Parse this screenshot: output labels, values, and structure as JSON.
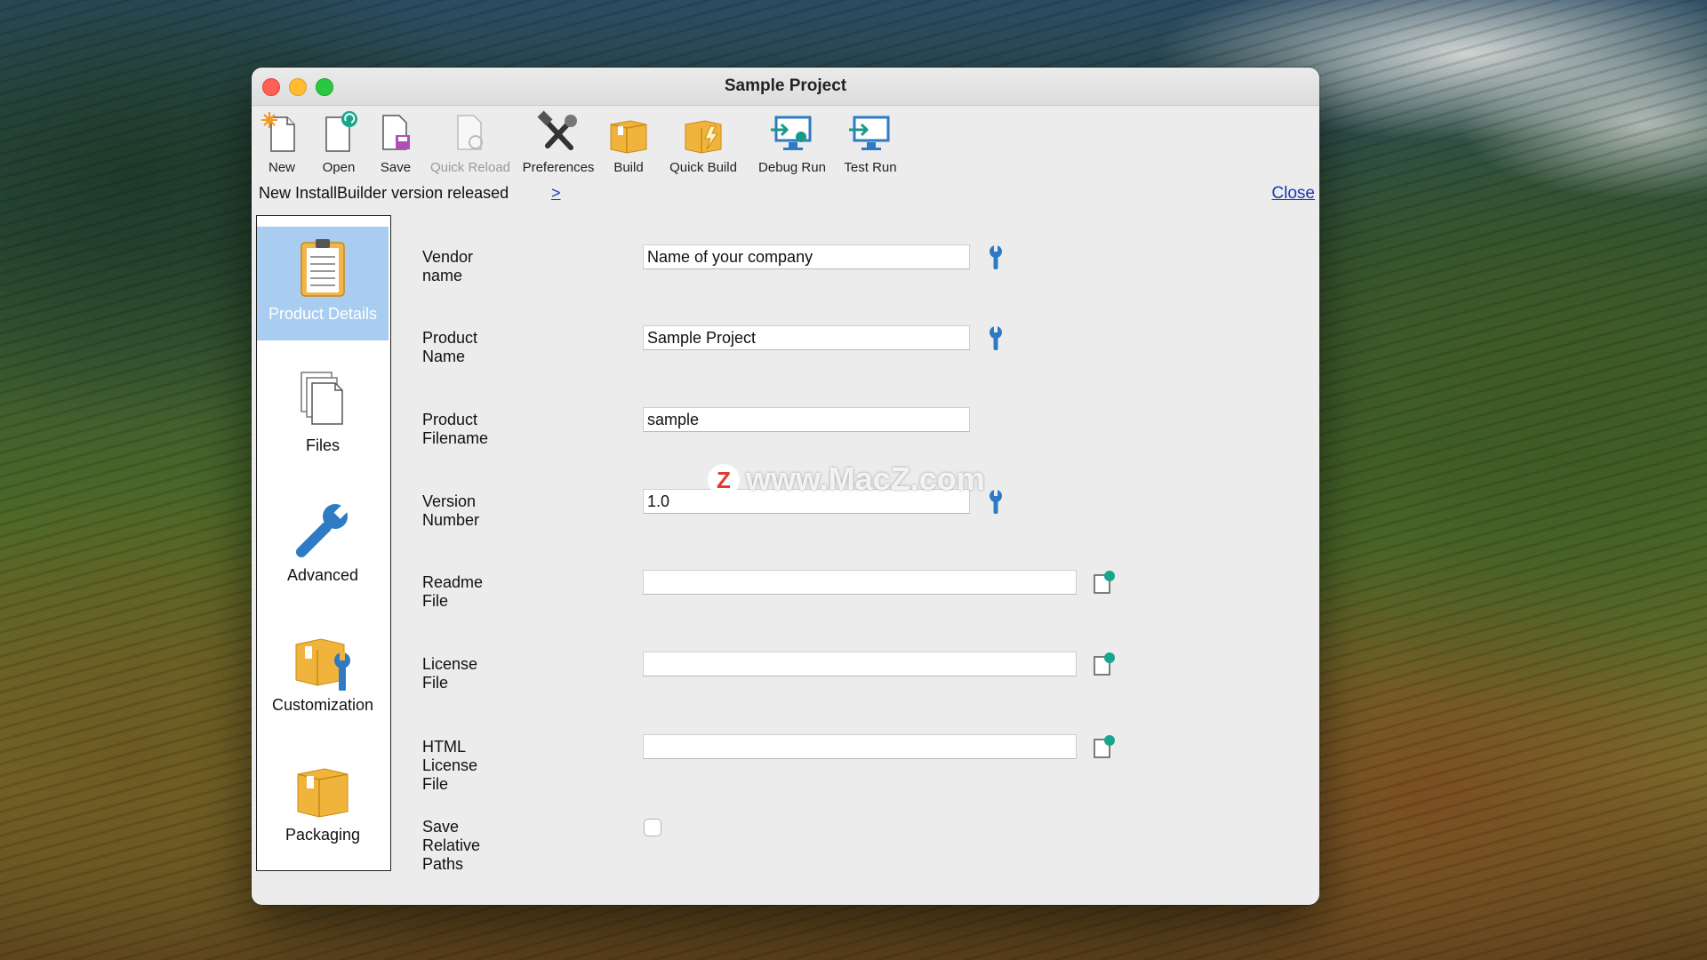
{
  "window": {
    "title": "Sample Project"
  },
  "toolbar": {
    "items": [
      {
        "label": "New",
        "icon": "new-file-icon",
        "enabled": true
      },
      {
        "label": "Open",
        "icon": "open-file-icon",
        "enabled": true
      },
      {
        "label": "Save",
        "icon": "save-icon",
        "enabled": true
      },
      {
        "label": "Quick Reload",
        "icon": "reload-icon",
        "enabled": false
      },
      {
        "label": "Preferences",
        "icon": "tools-icon",
        "enabled": true
      },
      {
        "label": "Build",
        "icon": "box-icon",
        "enabled": true
      },
      {
        "label": "Quick Build",
        "icon": "quick-build-icon",
        "enabled": true
      },
      {
        "label": "Debug Run",
        "icon": "debug-monitor-icon",
        "enabled": true
      },
      {
        "label": "Test Run",
        "icon": "monitor-icon",
        "enabled": true
      }
    ]
  },
  "notice": {
    "text": "New InstallBuilder version released",
    "link": ">",
    "close": "Close"
  },
  "sidebar": {
    "items": [
      {
        "label": "Product Details",
        "icon": "clipboard-icon",
        "selected": true
      },
      {
        "label": "Files",
        "icon": "files-icon",
        "selected": false
      },
      {
        "label": "Advanced",
        "icon": "wrench-icon",
        "selected": false
      },
      {
        "label": "Customization",
        "icon": "box-wrench-icon",
        "selected": false
      },
      {
        "label": "Packaging",
        "icon": "package-icon",
        "selected": false
      }
    ]
  },
  "form": {
    "vendor_name": {
      "label": "Vendor name",
      "value": "Name of your company"
    },
    "product_name": {
      "label": "Product Name",
      "value": "Sample Project"
    },
    "product_filename": {
      "label": "Product Filename",
      "value": "sample"
    },
    "version_number": {
      "label": "Version Number",
      "value": "1.0"
    },
    "readme_file": {
      "label": "Readme File",
      "value": ""
    },
    "license_file": {
      "label": "License File",
      "value": ""
    },
    "html_license_file": {
      "label": "HTML License File",
      "value": ""
    },
    "save_relative_paths": {
      "label": "Save Relative Paths",
      "checked": false
    }
  },
  "watermark": {
    "badge": "Z",
    "text": "www.MacZ.com"
  },
  "colors": {
    "selected_sidebar": "#a9cdf0",
    "link": "#1a38b8",
    "box_orange": "#f0b43c",
    "tool_blue": "#2e7bc4",
    "tool_teal": "#169a8a"
  }
}
